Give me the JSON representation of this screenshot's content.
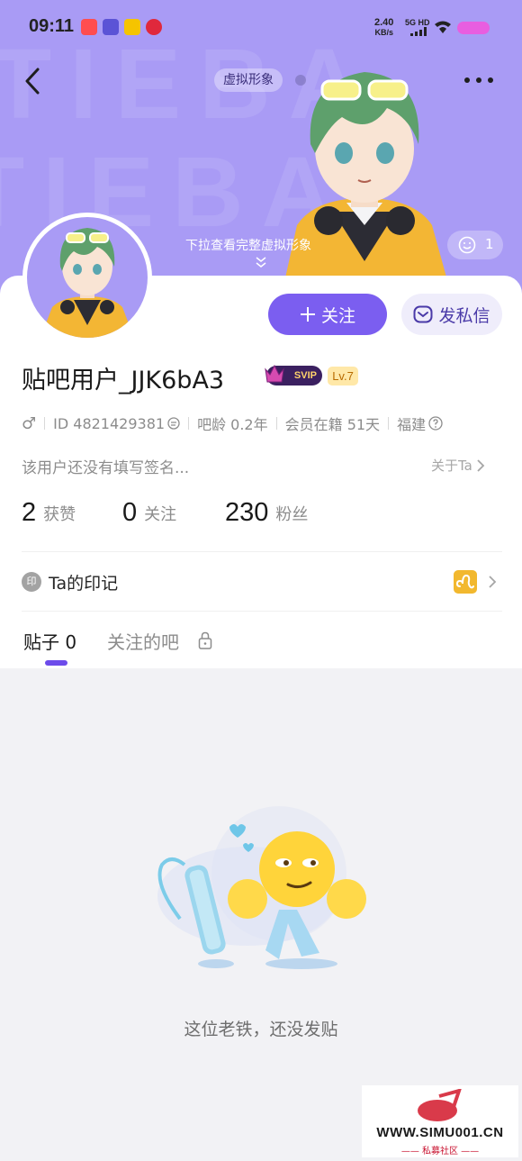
{
  "status_bar": {
    "time": "09:11",
    "net_speed_value": "2.40",
    "net_speed_unit": "KB/s",
    "net_type": "5G HD"
  },
  "header": {
    "background_word": "TIEBA",
    "avatar_tag": "虚拟形象",
    "pull_hint": "下拉查看完整虚拟形象",
    "like_count": "1"
  },
  "actions": {
    "follow_label": "关注",
    "message_label": "发私信"
  },
  "profile": {
    "username": "贴吧用户_JJK6bA3",
    "svip": "SVIP",
    "level": "Lv.7",
    "gender_symbol": "♂",
    "id_label": "ID 4821429381",
    "account_age": "吧龄 0.2年",
    "member_days": "会员在籍 51天",
    "location": "福建",
    "signature": "该用户还没有填写签名...",
    "about_label": "关于Ta"
  },
  "stats": [
    {
      "value": "2",
      "label": "获赞"
    },
    {
      "value": "0",
      "label": "关注"
    },
    {
      "value": "230",
      "label": "粉丝"
    }
  ],
  "seal": {
    "icon_text": "印",
    "label": "Ta的印记"
  },
  "tabs": [
    {
      "label": "贴子 0",
      "active": true
    },
    {
      "label": "关注的吧",
      "active": false
    }
  ],
  "empty_state": {
    "message": "这位老铁，还没发贴"
  },
  "watermark": {
    "site": "WWW.SIMU001.CN",
    "sub": "—— 私募社区 ——"
  },
  "colors": {
    "header_bg": "#a99bf5",
    "accent": "#7b5ef0",
    "svip_bg": "#3b2060",
    "zodiac": "#f2b82e"
  }
}
